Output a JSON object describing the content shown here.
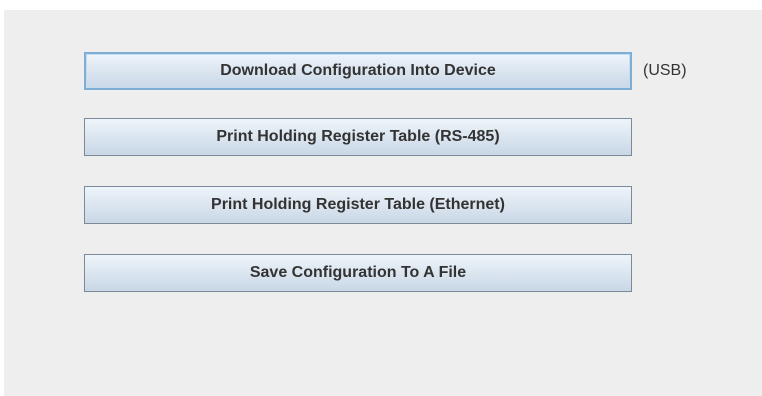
{
  "actions": {
    "download_label": "Download Configuration Into Device",
    "download_note": "(USB)",
    "print_rs485_label": "Print Holding Register Table (RS-485)",
    "print_ethernet_label": "Print Holding Register Table (Ethernet)",
    "save_label": "Save Configuration To A File"
  }
}
